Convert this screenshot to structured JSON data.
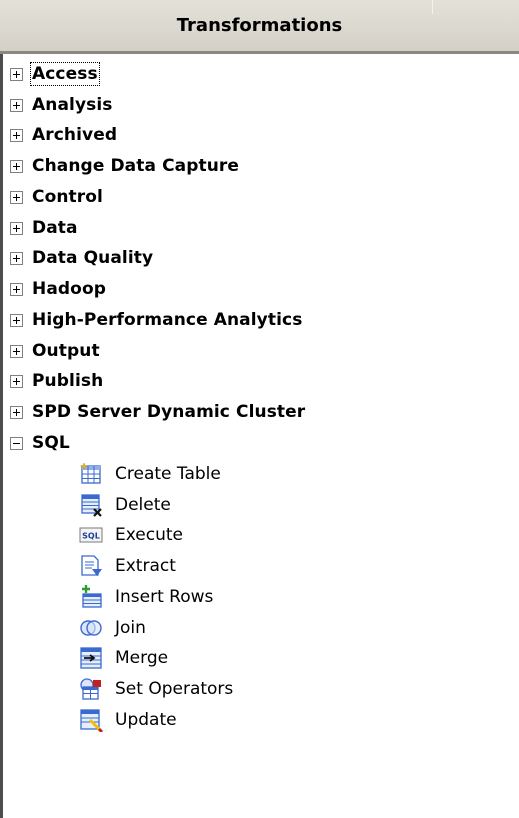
{
  "panel": {
    "title": "Transformations"
  },
  "tree": {
    "categories": [
      {
        "label": "Access",
        "expanded": false,
        "focused": true
      },
      {
        "label": "Analysis",
        "expanded": false
      },
      {
        "label": "Archived",
        "expanded": false
      },
      {
        "label": "Change Data Capture",
        "expanded": false
      },
      {
        "label": "Control",
        "expanded": false
      },
      {
        "label": "Data",
        "expanded": false
      },
      {
        "label": "Data Quality",
        "expanded": false
      },
      {
        "label": "Hadoop",
        "expanded": false
      },
      {
        "label": "High-Performance Analytics",
        "expanded": false
      },
      {
        "label": "Output",
        "expanded": false
      },
      {
        "label": "Publish",
        "expanded": false
      },
      {
        "label": "SPD Server Dynamic Cluster",
        "expanded": false
      },
      {
        "label": "SQL",
        "expanded": true
      }
    ],
    "sql_items": [
      {
        "label": "Create Table",
        "icon": "create-table-icon"
      },
      {
        "label": "Delete",
        "icon": "delete-icon"
      },
      {
        "label": "Execute",
        "icon": "sql-execute-icon"
      },
      {
        "label": "Extract",
        "icon": "extract-icon"
      },
      {
        "label": "Insert Rows",
        "icon": "insert-rows-icon"
      },
      {
        "label": "Join",
        "icon": "join-icon"
      },
      {
        "label": "Merge",
        "icon": "merge-icon"
      },
      {
        "label": "Set Operators",
        "icon": "set-operators-icon"
      },
      {
        "label": "Update",
        "icon": "update-icon"
      }
    ]
  },
  "colors": {
    "header_bg": "#d4d0c8",
    "table_blue": "#3a6ad0",
    "accent_green": "#2e9e2e",
    "accent_red": "#c42020",
    "accent_yellow": "#f2c200"
  }
}
